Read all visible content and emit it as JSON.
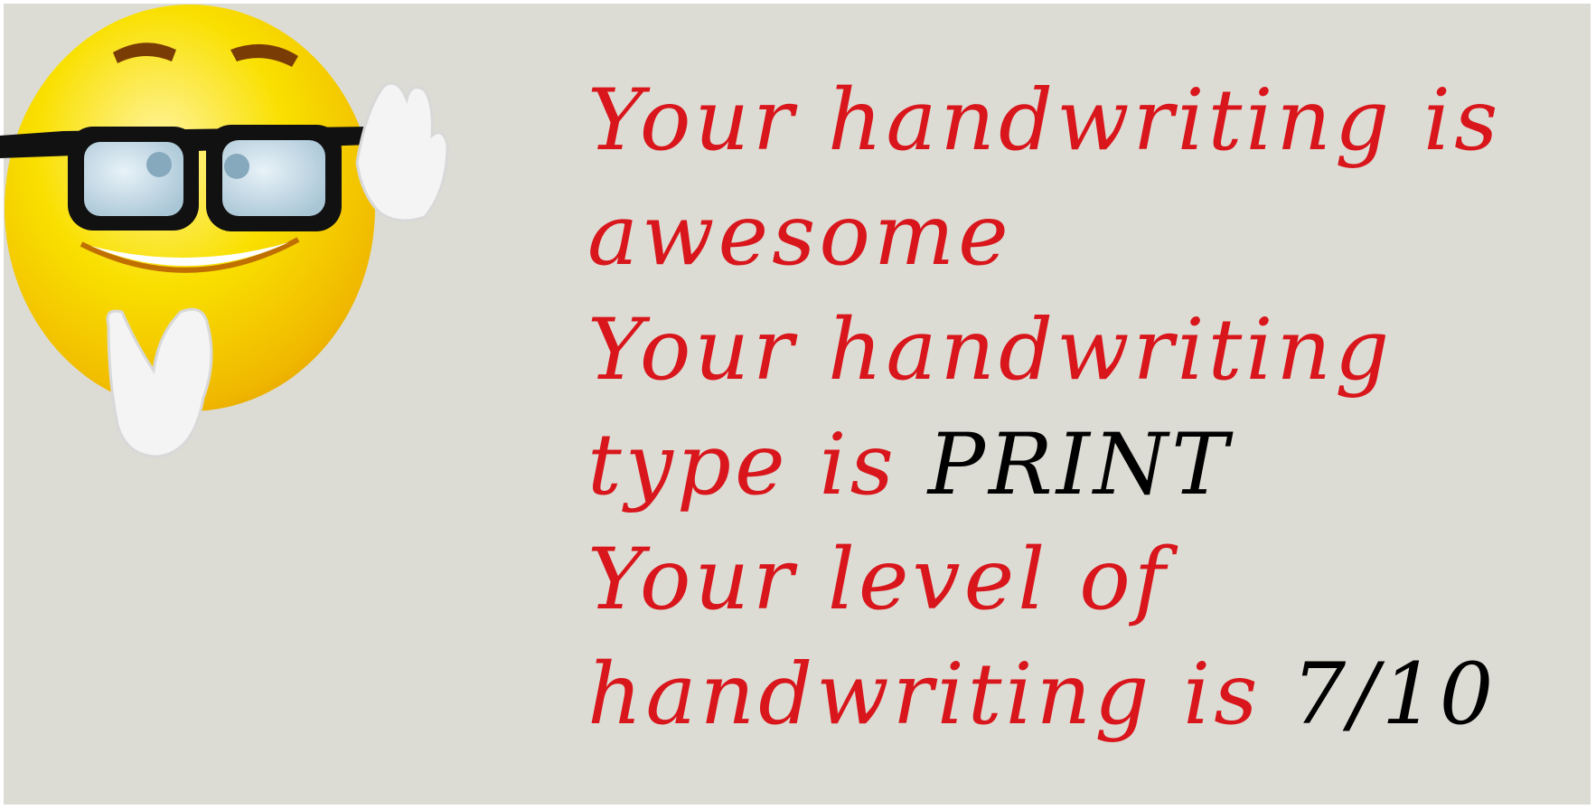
{
  "colors": {
    "background": "#dcdcd4",
    "text_red": "#d9161c",
    "text_black": "#000000",
    "emoji_yellow": "#f7d800",
    "glasses": "#111111"
  },
  "icons": {
    "emoji": "nerd-face-with-glasses-emoji"
  },
  "message": {
    "line1": "Your handwriting is",
    "line2": "awesome",
    "line3": "Your handwriting",
    "line4_prefix": "type is ",
    "line4_value": "PRINT",
    "line5": "Your level of",
    "line6_prefix": "handwriting is ",
    "line6_value": "7/10"
  }
}
